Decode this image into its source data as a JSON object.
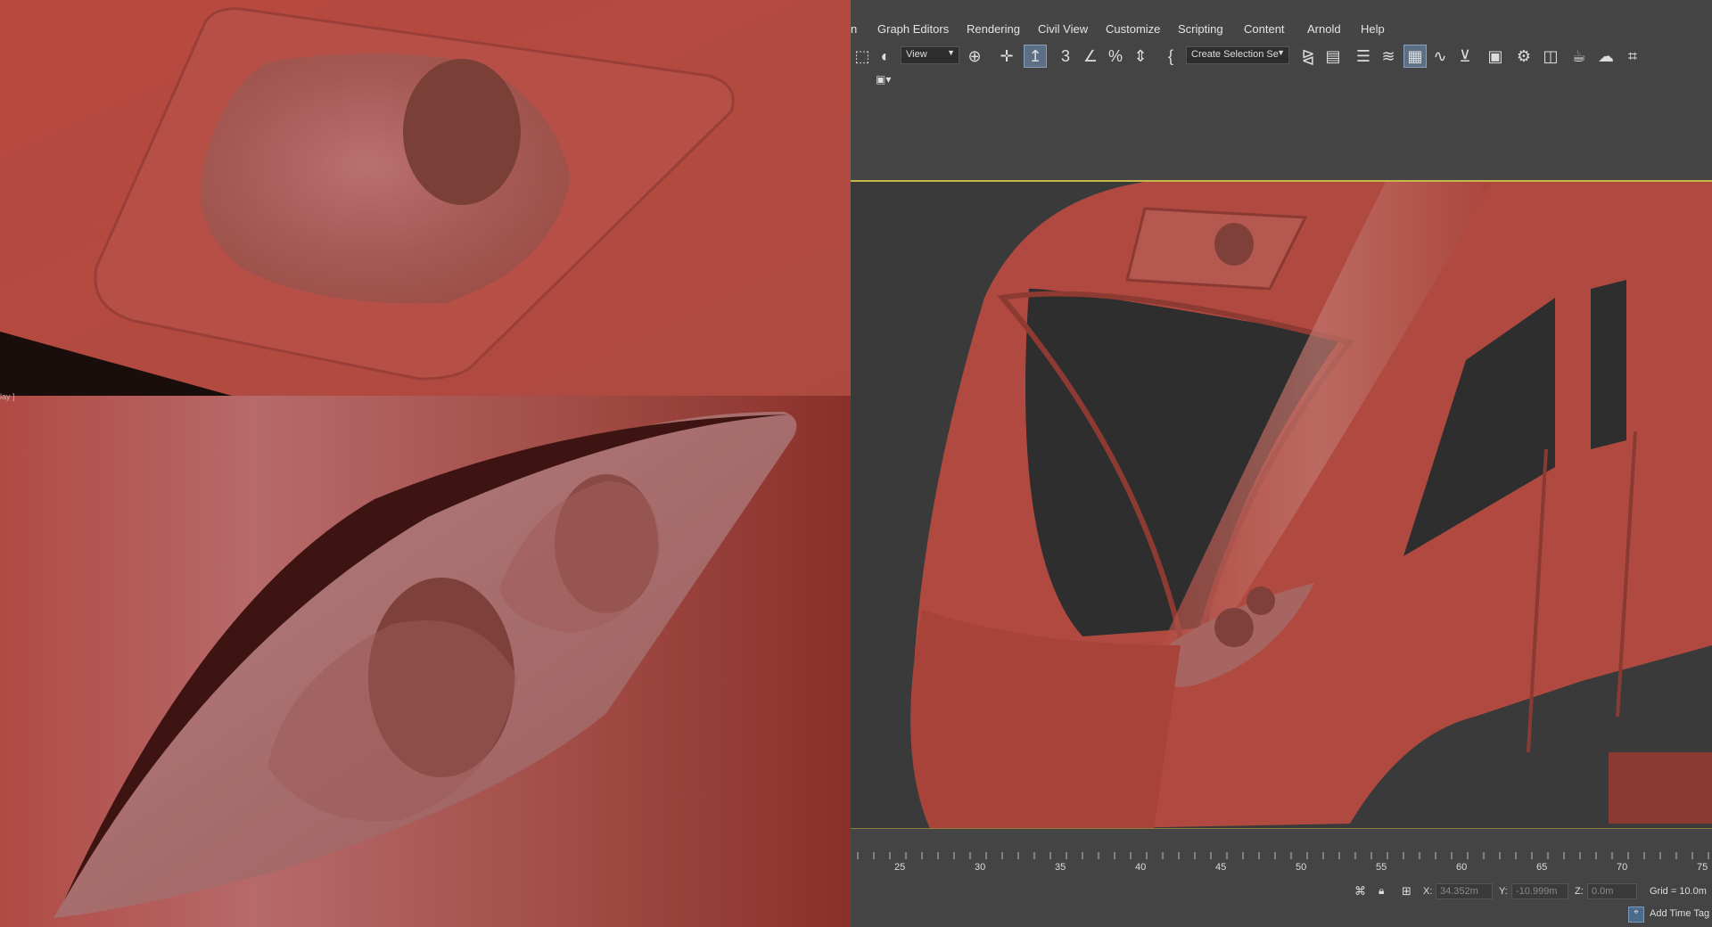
{
  "left_panels": {
    "tag_text": "lay ]"
  },
  "menu": {
    "items": [
      "n",
      "Graph Editors",
      "Rendering",
      "Civil View",
      "Customize",
      "Scripting",
      "Content",
      "Arnold",
      "Help"
    ]
  },
  "toolbar": {
    "view_dropdown": "View",
    "selection_set": "Create Selection Se"
  },
  "timeline": {
    "ticks": [
      "25",
      "30",
      "35",
      "40",
      "45",
      "50",
      "55",
      "60",
      "65",
      "70",
      "75"
    ]
  },
  "status": {
    "x_label": "X:",
    "x_value": "34.352m",
    "y_label": "Y:",
    "y_value": "-10.999m",
    "z_label": "Z:",
    "z_value": "0.0m",
    "grid": "Grid = 10.0m",
    "add_time_tag": "Add Time Tag"
  },
  "colors": {
    "model_red": "#b24a40",
    "viewport_bg": "#3a3a3a",
    "ui_bg": "#444444",
    "viewport_border": "#c8b84a"
  }
}
